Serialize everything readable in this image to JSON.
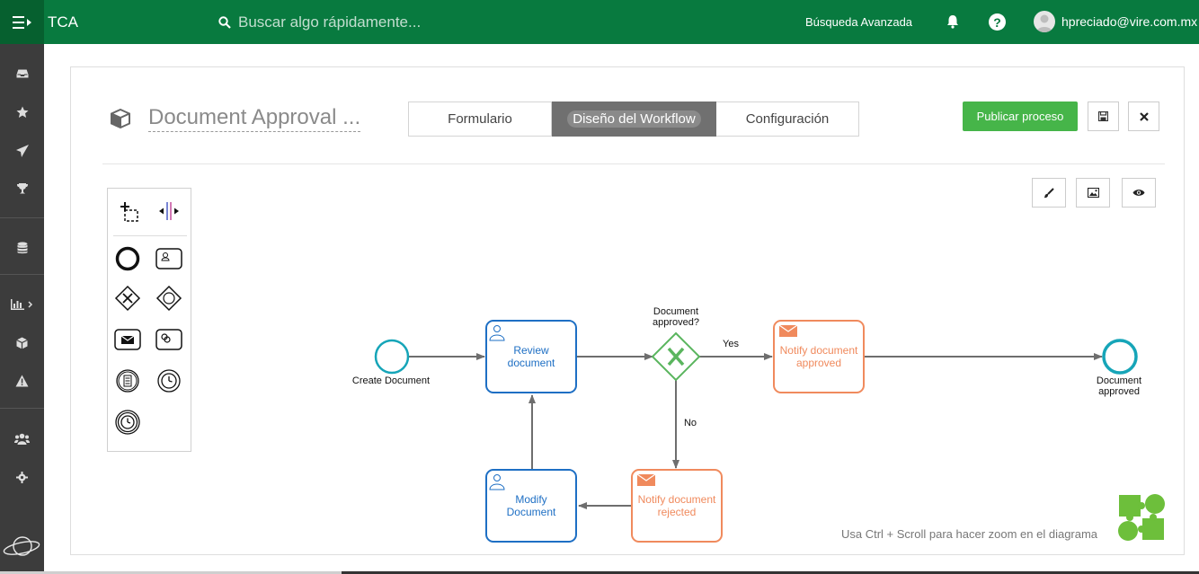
{
  "app": {
    "name": "TCA",
    "search_placeholder": "Buscar algo rápidamente...",
    "advanced_search": "Búsqueda Avanzada",
    "help_glyph": "?",
    "user_email": "hpreciado@vire.com.mx",
    "brand_color": "#087a3f"
  },
  "process": {
    "title": "Document Approval ...",
    "tabs": [
      {
        "label": "Formulario",
        "active": false
      },
      {
        "label": "Diseño del Workflow",
        "active": true
      },
      {
        "label": "Configuración",
        "active": false
      }
    ],
    "publish_label": "Publicar proceso"
  },
  "sidebar_icons": [
    "inbox-icon",
    "star-icon",
    "send-icon",
    "trophy-icon",
    "database-icon",
    "chart-icon",
    "cube-icon",
    "warning-icon",
    "users-icon",
    "gear-icon",
    "planet-icon"
  ],
  "palette_icons": [
    "lasso-tool-icon",
    "space-tool-icon",
    "end-event-icon",
    "user-task-icon",
    "exclusive-gateway-icon",
    "event-gateway-icon",
    "send-task-icon",
    "service-task-icon",
    "conditional-event-icon",
    "timer-event-icon",
    "intermediate-timer-icon"
  ],
  "diagram": {
    "start_event": "Create Document",
    "review_task": [
      "Review",
      "document"
    ],
    "gateway": [
      "Document",
      "approved?"
    ],
    "yes_label": "Yes",
    "no_label": "No",
    "notify_approved": [
      "Notify document",
      "approved"
    ],
    "notify_rejected": [
      "Notify document",
      "rejected"
    ],
    "modify_task": [
      "Modify",
      "Document"
    ],
    "end_event": [
      "Document",
      "approved"
    ]
  },
  "hint": "Usa Ctrl + Scroll para hacer zoom en el diagrama",
  "colors": {
    "task_blue": "#1e6fc4",
    "task_orange": "#f08a5d",
    "gateway_green": "#5ab55e",
    "event_teal": "#16a5b8",
    "publish_green": "#46b549"
  }
}
